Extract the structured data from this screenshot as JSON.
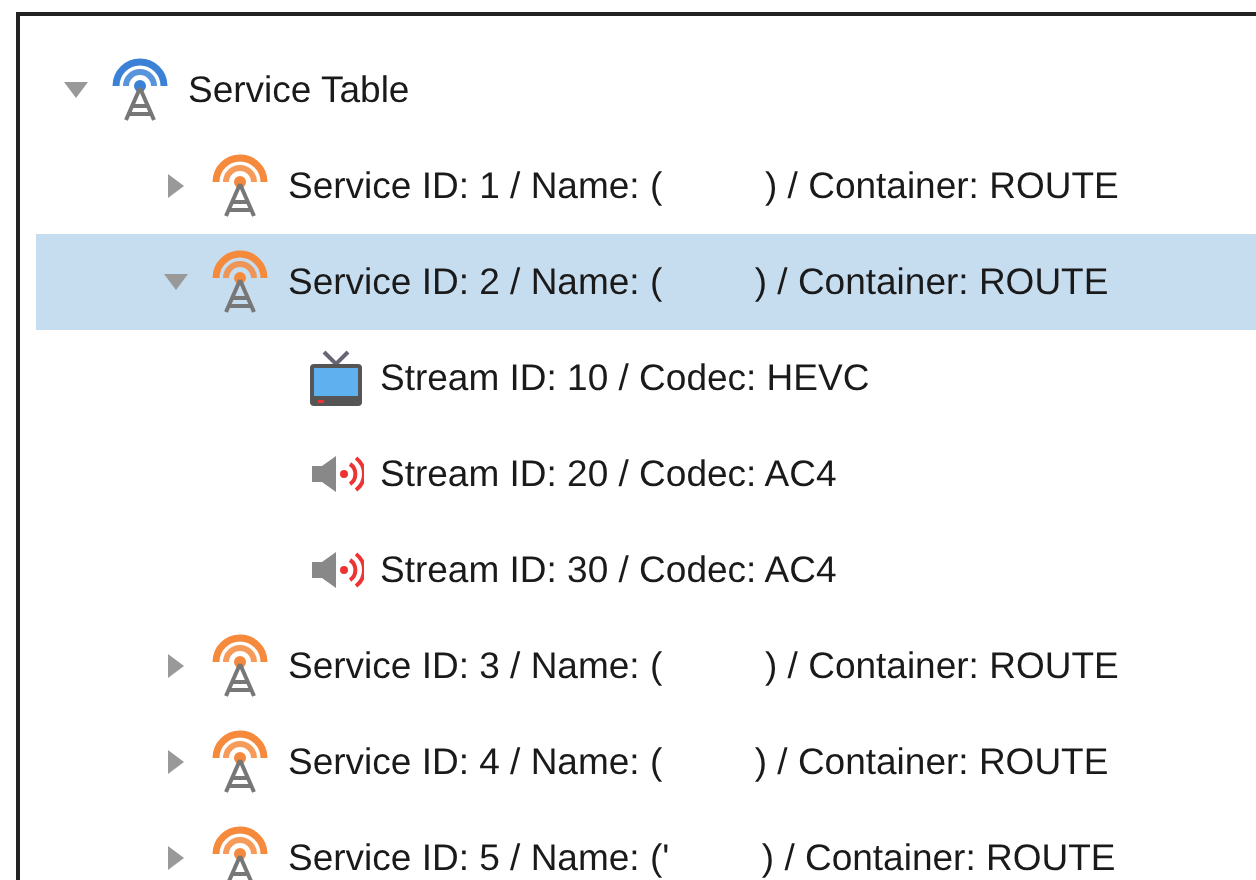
{
  "tree": [
    {
      "kind": "table",
      "label": "Service Table",
      "expanded": true,
      "selected": false,
      "children": [
        {
          "kind": "service",
          "label": "Service ID: 1 / Name: (          ) / Container: ROUTE",
          "expanded": false,
          "selected": false
        },
        {
          "kind": "service",
          "label": "Service ID: 2 / Name: (         ) / Container: ROUTE",
          "expanded": true,
          "selected": true,
          "children": [
            {
              "kind": "video",
              "label": "Stream ID: 10 / Codec: HEVC",
              "selected": false
            },
            {
              "kind": "audio",
              "label": "Stream ID: 20 / Codec: AC4",
              "selected": false
            },
            {
              "kind": "audio",
              "label": "Stream ID: 30 / Codec: AC4",
              "selected": false
            }
          ]
        },
        {
          "kind": "service",
          "label": "Service ID: 3 / Name: (          ) / Container: ROUTE",
          "expanded": false,
          "selected": false
        },
        {
          "kind": "service",
          "label": "Service ID: 4 / Name: (         ) / Container: ROUTE",
          "expanded": false,
          "selected": false
        },
        {
          "kind": "service",
          "label": "Service ID: 5 / Name: ('         ) / Container: ROUTE",
          "expanded": false,
          "selected": false
        }
      ]
    }
  ]
}
